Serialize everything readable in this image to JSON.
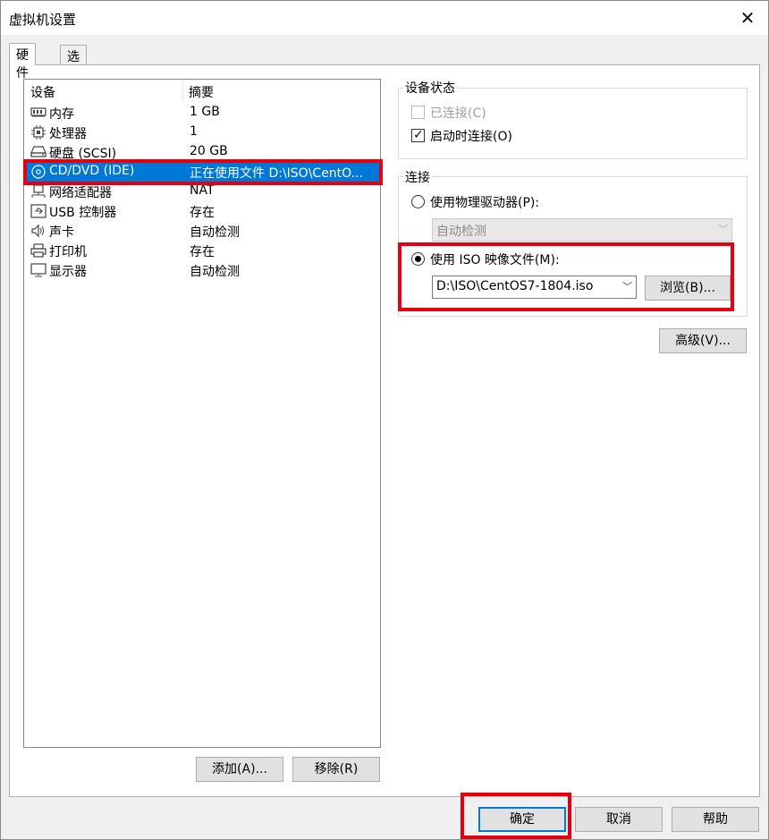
{
  "window": {
    "title": "虚拟机设置",
    "close_glyph": "✕"
  },
  "tabs": [
    {
      "label": "硬件"
    },
    {
      "label": "选项"
    }
  ],
  "device_list": {
    "headers": {
      "device": "设备",
      "summary": "摘要"
    },
    "rows": [
      {
        "icon": "memory-icon",
        "name": "内存",
        "summary": "1 GB"
      },
      {
        "icon": "processor-icon",
        "name": "处理器",
        "summary": "1"
      },
      {
        "icon": "hard-disk-icon",
        "name": "硬盘 (SCSI)",
        "summary": "20 GB"
      },
      {
        "icon": "cd-dvd-icon",
        "name": "CD/DVD (IDE)",
        "summary": "正在使用文件 D:\\ISO\\CentO..."
      },
      {
        "icon": "network-adapter-icon",
        "name": "网络适配器",
        "summary": "NAT"
      },
      {
        "icon": "usb-controller-icon",
        "name": "USB 控制器",
        "summary": "存在"
      },
      {
        "icon": "sound-card-icon",
        "name": "声卡",
        "summary": "自动检测"
      },
      {
        "icon": "printer-icon",
        "name": "打印机",
        "summary": "存在"
      },
      {
        "icon": "display-icon",
        "name": "显示器",
        "summary": "自动检测"
      }
    ],
    "selected_index": 3
  },
  "left_buttons": {
    "add": "添加(A)...",
    "remove": "移除(R)"
  },
  "device_status": {
    "title": "设备状态",
    "connected": {
      "label": "已连接(C)",
      "checked": false,
      "enabled": false
    },
    "connect_at_power_on": {
      "label": "启动时连接(O)",
      "checked": true,
      "enabled": true
    }
  },
  "connection": {
    "title": "连接",
    "physical_drive": {
      "label": "使用物理驱动器(P):",
      "selected": false,
      "combo_value": "自动检测"
    },
    "iso_image": {
      "label": "使用 ISO 映像文件(M):",
      "selected": true,
      "combo_value": "D:\\ISO\\CentOS7-1804.iso",
      "browse_label": "浏览(B)..."
    }
  },
  "advanced_button": "高级(V)...",
  "footer": {
    "ok": "确定",
    "cancel": "取消",
    "help": "帮助"
  },
  "icons": {
    "combo_arrow": "﹀",
    "check": "✓"
  },
  "colors": {
    "selection": "#0078d7",
    "highlight_box": "#e3000f"
  }
}
